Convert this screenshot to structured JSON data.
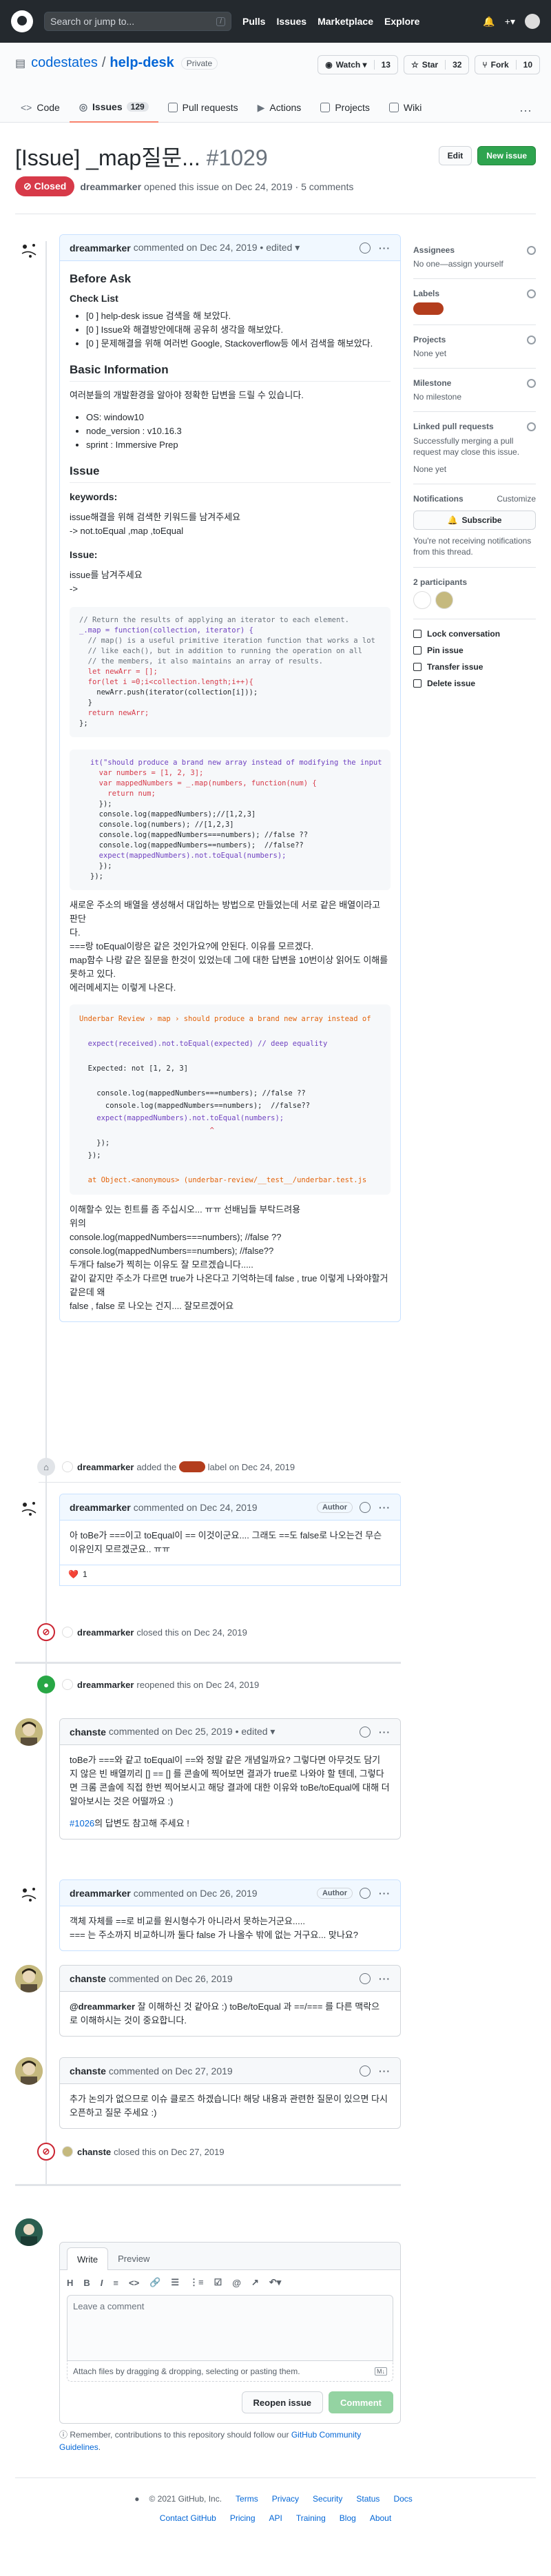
{
  "header": {
    "search_placeholder": "Search or jump to...",
    "search_key": "/",
    "nav": [
      "Pulls",
      "Issues",
      "Marketplace",
      "Explore"
    ],
    "plus": "+▾"
  },
  "repo": {
    "owner": "codestates",
    "name": "help-desk",
    "visibility": "Private",
    "watch_label": "Watch ▾",
    "watch_count": "13",
    "star_label": "Star",
    "star_count": "32",
    "fork_label": "Fork",
    "fork_count": "10",
    "tabs": [
      {
        "label": "Code"
      },
      {
        "label": "Issues",
        "count": "129"
      },
      {
        "label": "Pull requests"
      },
      {
        "label": "Actions"
      },
      {
        "label": "Projects"
      },
      {
        "label": "Wiki"
      }
    ],
    "more": "···"
  },
  "issue": {
    "title": "[Issue] _map질문...",
    "number": "#1029",
    "edit_label": "Edit",
    "new_issue_label": "New issue",
    "state": "Closed",
    "author": "dreammarker",
    "opened_text": "opened this issue on Dec 24, 2019 · 5 comments"
  },
  "comment1": {
    "author": "dreammarker",
    "meta": "commented on Dec 24, 2019 • edited ▾",
    "before_ask": "Before Ask",
    "checklist_title": "Check List",
    "checklist": [
      "[0 ] help-desk issue 검색을 해 보았다.",
      "[0 ] Issue와 해결방안에대해 공유히 생각을 해보았다.",
      "[0 ] 문제해결을 위해 여러번 Google, Stackoverflow등 에서 검색을 해보았다."
    ],
    "basic_info_title": "Basic Information",
    "basic_info_desc": "여러분들의 개발환경을 알아야 정확한 답변을 드릴 수 있습니다.",
    "basic_info": [
      "OS: window10",
      "node_version : v10.16.3",
      "sprint : Immersive Prep"
    ],
    "issue_title": "Issue",
    "keywords_label": "keywords:",
    "keywords_desc": "issue해결을 위해 검색한 키워드를 남겨주세요",
    "keywords_value": "-> not.toEqual ,map ,toEqual",
    "issue_label": "Issue:",
    "issue_desc": "issue를 남겨주세요",
    "issue_arrow": "->",
    "code1": [
      "// Return the results of applying an iterator to each element.",
      "_.map = function(collection, iterator) {",
      "  // map() is a useful primitive iteration function that works a lot",
      "  // like each(), but in addition to running the operation on all",
      "  // the members, it also maintains an array of results.",
      "  let newArr = [];",
      "  for(let i =0;i<collection.length;i++){",
      "    newArr.push(iterator(collection[i]));",
      "  }",
      "  return newArr;",
      "};"
    ],
    "code2": [
      "it(\"should produce a brand new array instead of modifying the input",
      "  var numbers = [1, 2, 3];",
      "  var mappedNumbers = _.map(numbers, function(num) {",
      "    return num;",
      "  });",
      "  console.log(mappedNumbers);//[1,2,3]",
      "  console.log(numbers); //[1,2,3]",
      "  console.log(mappedNumbers===numbers); //false ??",
      "  console.log(mappedNumbers==numbers);  //false??",
      "  expect(mappedNumbers).not.toEqual(numbers);",
      "  });",
      "});"
    ],
    "para1": [
      "새로운 주소의 배열을 생성해서 대입하는 방법으로 만들었는데 서로 같은 배열이라고 판단",
      "다.",
      "===랑 toEqual이랑은 같은 것인가요?에 안된다. 이유를 모르겠다.",
      "map함수 나랑 같은 질문을 한것이 있었는데 그에 대한 답변을 10번이상 읽어도 이해를",
      "못하고 있다.",
      "에러메세지는 이렇게 나온다."
    ],
    "code3": [
      "Underbar Review › map › should produce a brand new array instead of",
      "",
      "  expect(received).not.toEqual(expected) // deep equality",
      "",
      "  Expected: not [1, 2, 3]",
      "",
      "    console.log(mappedNumbers===numbers); //false ??",
      "      console.log(mappedNumbers==numbers);  //false??",
      "    expect(mappedNumbers).not.toEqual(numbers);",
      "                              ^",
      "    });",
      "  });",
      "",
      "  at Object.<anonymous> (underbar-review/__test__/underbar.test.js"
    ],
    "para2": [
      "이해할수 있는 힌트를 좀 주십시오... ㅠㅠ 선배님들 부탁드려용",
      "위의",
      "console.log(mappedNumbers===numbers); //false ??",
      "console.log(mappedNumbers==numbers);  //false??",
      "두개다 false가 찍히는 이유도 잘 모르겠습니다.....",
      "같이 같지만 주소가 다르면 true가 나온다고 기억하는데 false , true 이렇게 나와야할거",
      "같은데 왜",
      "false , false 로 나오는 건지.... 잘모르겠어요"
    ]
  },
  "event_label": {
    "actor": "dreammarker",
    "text_before": "added the",
    "label_name": "",
    "text_after": "label on Dec 24, 2019",
    "label_color": "#b33d1d"
  },
  "comment2": {
    "author": "dreammarker",
    "meta": "commented on Dec 24, 2019",
    "role": "Author",
    "body": [
      "아 toBe가 ===이고 toEqual이 == 이것이군요.... 그래도 ==도 false로 나오는건 무슨",
      "이유인지 모르겠군요.. ㅠㅠ"
    ],
    "reaction_emoji": "❤️",
    "reaction_count": "1"
  },
  "event_closed1": {
    "actor": "dreammarker",
    "text": "closed this on Dec 24, 2019"
  },
  "event_reopened": {
    "actor": "dreammarker",
    "text": "reopened this on Dec 24, 2019"
  },
  "comment3": {
    "author": "chanste",
    "meta": "commented on Dec 25, 2019 • edited ▾",
    "body": [
      "toBe가 ===와 같고 toEqual이 ==와 정말 같은 개념일까요? 그렇다면 아무것도 담기",
      "지 않은 빈 배열끼리 [] == [] 를 콘솔에 찍어보면 결과가 true로 나와야 할 텐데, 그렇다",
      "면 크롬 콘솔에 직접 한번 찍어보시고 해당 결과에 대한 이유와 toBe/toEqual에 대해 더",
      "알아보시는 것은 어떨까요 :)"
    ],
    "ref_link": "#1026",
    "ref_text": "의 답변도 참고해 주세요 !"
  },
  "comment4": {
    "author": "dreammarker",
    "meta": "commented on Dec 26, 2019",
    "role": "Author",
    "body": [
      "객체 자체를 ==로 비교를 원시형수가 아니라서 못하는거군요.....",
      "=== 는 주소까지 비교하니까 둘다 false 가 나올수 밖에 없는 거구요... 맞나요?"
    ]
  },
  "comment5": {
    "author": "chanste",
    "meta": "commented on Dec 26, 2019",
    "mention": "@dreammarker",
    "body_line1": " 잘 이해하신 것 같아요 :) toBe/toEqual 과 ==/=== 를 다른 맥락으",
    "body_line2": "로 이해하시는 것이 중요합니다."
  },
  "comment6": {
    "author": "chanste",
    "meta": "commented on Dec 27, 2019",
    "body": [
      "추가 논의가 없으므로 이슈 클로즈 하겠습니다! 해당 내용과 관련한 질문이 있으면 다시",
      "오픈하고 질문 주세요 :)"
    ]
  },
  "event_closed2": {
    "actor": "chanste",
    "text": "closed this on Dec 27, 2019"
  },
  "editor": {
    "tab_write": "Write",
    "tab_preview": "Preview",
    "toolbar": [
      "H",
      "B",
      "I",
      "≡",
      "<>",
      "🔗",
      "☰",
      "⋮≡",
      "☑",
      "@",
      "↗",
      "↶▾"
    ],
    "placeholder": "Leave a comment",
    "attach_text": "Attach files by dragging & dropping, selecting or pasting them.",
    "md_badge": "M↓",
    "reopen_label": "Reopen issue",
    "comment_label": "Comment"
  },
  "remember": {
    "text": "Remember, contributions to this repository should follow our ",
    "link": "GitHub Community Guidelines",
    "end": "."
  },
  "sidebar": {
    "assignees_title": "Assignees",
    "assignees_value": "No one—assign yourself",
    "labels_title": "Labels",
    "projects_title": "Projects",
    "projects_value": "None yet",
    "milestone_title": "Milestone",
    "milestone_value": "No milestone",
    "linked_title": "Linked pull requests",
    "linked_desc": "Successfully merging a pull request may close this issue.",
    "linked_value": "None yet",
    "notifications_title": "Notifications",
    "customize": "Customize",
    "subscribe_label": "Subscribe",
    "notif_desc": "You're not receiving notifications from this thread.",
    "participants": "2 participants",
    "lock": "Lock conversation",
    "pin": "Pin issue",
    "transfer": "Transfer issue",
    "delete": "Delete issue"
  },
  "footer": {
    "copyright": "© 2021 GitHub, Inc.",
    "row1": [
      "Terms",
      "Privacy",
      "Security",
      "Status",
      "Docs"
    ],
    "row2": [
      "Contact GitHub",
      "Pricing",
      "API",
      "Training",
      "Blog",
      "About"
    ]
  }
}
